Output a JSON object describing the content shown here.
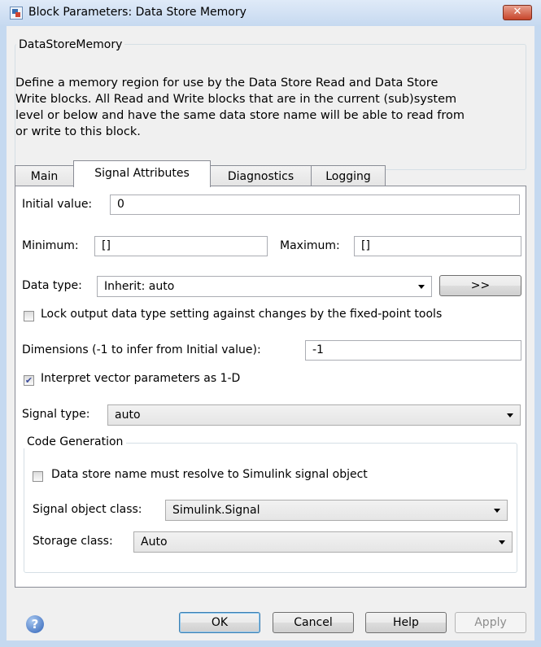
{
  "window": {
    "title": "Block Parameters: Data Store Memory",
    "close_label": "✕"
  },
  "description": {
    "legend": "DataStoreMemory",
    "lines": [
      "Define a memory region for use by the Data Store Read and Data Store",
      "Write blocks. All Read and Write blocks that are in the current (sub)system",
      "level or below and have the same data store name will be able to read from",
      "or write to this block."
    ]
  },
  "tabs": [
    "Main",
    "Signal Attributes",
    "Diagnostics",
    "Logging"
  ],
  "active_tab": "Signal Attributes",
  "signal_attributes": {
    "initial_value_label": "Initial value:",
    "initial_value": "0",
    "minimum_label": "Minimum:",
    "minimum_value": "[]",
    "maximum_label": "Maximum:",
    "maximum_value": "[]",
    "data_type_label": "Data type:",
    "data_type_value": "Inherit: auto",
    "data_type_assistant_label": ">>",
    "lock_label": "Lock output data type setting against changes by the fixed-point tools",
    "lock_checked": false,
    "dimensions_label": "Dimensions (-1 to infer from Initial value):",
    "dimensions_value": "-1",
    "interpret_label": "Interpret vector parameters as 1-D",
    "interpret_checked": true,
    "signal_type_label": "Signal type:",
    "signal_type_value": "auto"
  },
  "code_generation": {
    "legend": "Code Generation",
    "resolve_label": "Data store name must resolve to Simulink signal object",
    "resolve_checked": false,
    "signal_object_class_label": "Signal object class:",
    "signal_object_class_value": "Simulink.Signal",
    "storage_class_label": "Storage class:",
    "storage_class_value": "Auto"
  },
  "buttons": {
    "help_icon_label": "?",
    "ok": "OK",
    "cancel": "Cancel",
    "help": "Help",
    "apply": "Apply"
  },
  "colors": {
    "frame": "#c5d9f0",
    "client": "#f0f0f0",
    "close_red": "#c7452b"
  }
}
